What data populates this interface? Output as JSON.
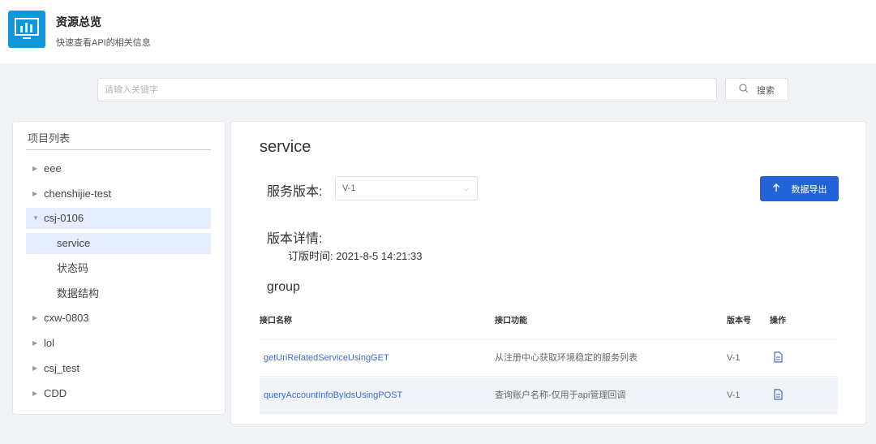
{
  "header": {
    "title": "资源总览",
    "subtitle": "快速查看API的相关信息",
    "logo_icon": "chart-monitor-icon"
  },
  "search": {
    "placeholder": "请输入关键字",
    "button_label": "搜索",
    "button_icon": "search-icon"
  },
  "sidebar": {
    "title": "项目列表",
    "items": [
      {
        "label": "eee",
        "expanded": false,
        "selected": false,
        "level": 0
      },
      {
        "label": "chenshijie-test",
        "expanded": false,
        "selected": false,
        "level": 0
      },
      {
        "label": "csj-0106",
        "expanded": true,
        "selected": true,
        "level": 0
      },
      {
        "label": "service",
        "expanded": false,
        "selected": true,
        "level": 1
      },
      {
        "label": "状态码",
        "expanded": false,
        "selected": false,
        "level": 1
      },
      {
        "label": "数据结构",
        "expanded": false,
        "selected": false,
        "level": 1
      },
      {
        "label": "cxw-0803",
        "expanded": false,
        "selected": false,
        "level": 0
      },
      {
        "label": "lol",
        "expanded": false,
        "selected": false,
        "level": 0
      },
      {
        "label": "csj_test",
        "expanded": false,
        "selected": false,
        "level": 0
      },
      {
        "label": "CDD",
        "expanded": false,
        "selected": false,
        "level": 0
      }
    ]
  },
  "main": {
    "title": "service",
    "version_label": "服务版本:",
    "version_value": "V-1",
    "export_label": "数据导出",
    "export_icon": "arrow-up-icon",
    "detail_title": "版本详情:",
    "detail_time": "订版时间: 2021-8-5 14:21:33",
    "group_title": "group",
    "table": {
      "headers": [
        "接口名称",
        "接口功能",
        "版本号",
        "操作"
      ],
      "rows": [
        {
          "name": "getUriRelatedServiceUsingGET",
          "desc": "从注册中心获取环境稳定的服务列表",
          "version": "V-1",
          "action_icon": "document-view-icon"
        },
        {
          "name": "queryAccountInfoByIdsUsingPOST",
          "desc": "查询账户名称-仅用于api管理回调",
          "version": "V-1",
          "action_icon": "document-view-icon"
        }
      ]
    }
  },
  "colors": {
    "accent": "#2264d8",
    "logo_bg": "#1296db",
    "selected_bg": "#e5edfc",
    "link": "#3f6bd0",
    "page_bg": "#f0f2f5"
  }
}
